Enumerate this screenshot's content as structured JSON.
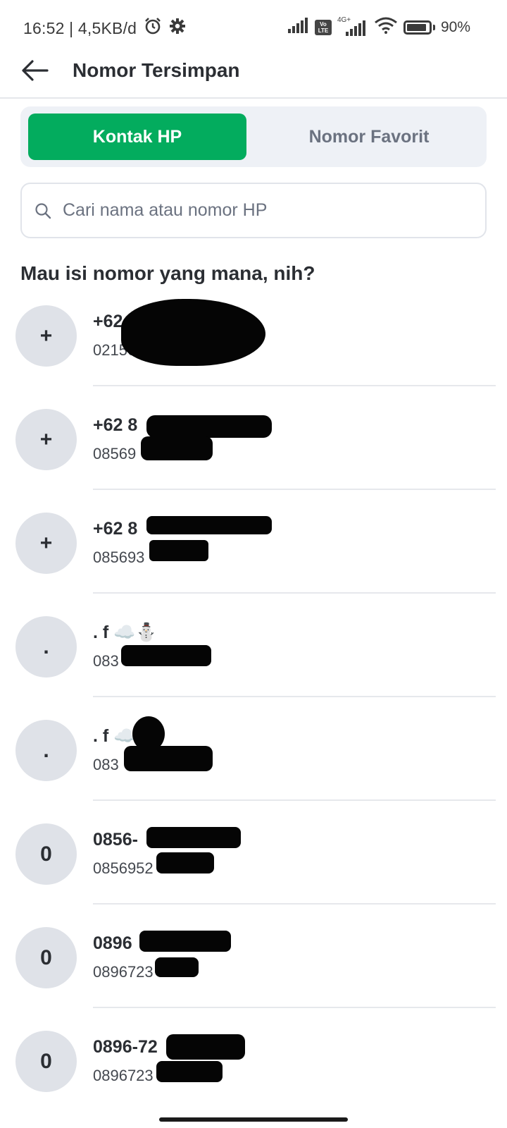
{
  "status_bar": {
    "time": "16:52",
    "network_speed": "4,5KB/d",
    "network_type": "4G+",
    "volte": "Vo LTE",
    "battery": "90%",
    "icons": [
      "alarm-icon",
      "settings-icon",
      "signal-icon",
      "volte-icon",
      "wifi-icon",
      "battery-icon"
    ]
  },
  "header": {
    "title": "Nomor Tersimpan",
    "back_icon": "arrow-left-icon"
  },
  "tabs": [
    {
      "label": "Kontak HP",
      "active": true
    },
    {
      "label": "Nomor Favorit",
      "active": false
    }
  ],
  "search": {
    "placeholder": "Cari nama atau nomor HP",
    "value": "",
    "icon": "search-icon"
  },
  "section_title": "Mau isi nomor yang mana, nih?",
  "contacts": [
    {
      "avatar": "+",
      "name": "+62",
      "number": "02150"
    },
    {
      "avatar": "+",
      "name": "+62 8",
      "number": "08569"
    },
    {
      "avatar": "+",
      "name": "+62 8",
      "number": "085693"
    },
    {
      "avatar": ".",
      "name": ". f ☁️⛄",
      "number": "083"
    },
    {
      "avatar": ".",
      "name": ". f ☁️",
      "number": "083"
    },
    {
      "avatar": "0",
      "name": "0856-",
      "number": "0856952"
    },
    {
      "avatar": "0",
      "name": "0896",
      "number": "0896723"
    },
    {
      "avatar": "0",
      "name": "0896-72",
      "number": "0896723"
    }
  ],
  "colors": {
    "accent": "#03ac5e",
    "tab_bg": "#eef1f6",
    "avatar_bg": "#dfe2e8",
    "text_primary": "#2b2e33",
    "text_muted": "#6b7280"
  }
}
